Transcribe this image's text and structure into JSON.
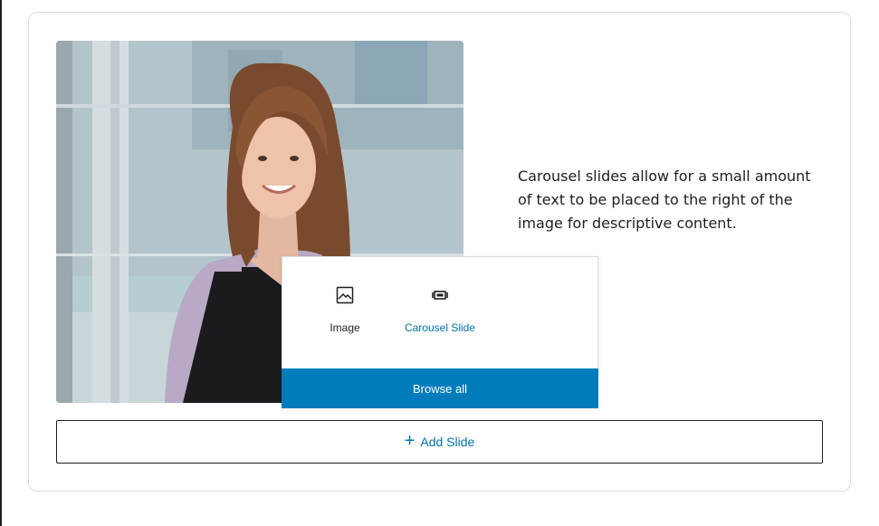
{
  "slide": {
    "description": "Carousel slides allow for a small amount of text to be placed to the right of the image for descriptive content."
  },
  "inserter": {
    "items": [
      {
        "label": "Image",
        "icon": "image-icon"
      },
      {
        "label": "Carousel Slide",
        "icon": "carousel-slide-icon"
      }
    ],
    "browse_all_label": "Browse all"
  },
  "add_slide": {
    "icon": "plus-icon",
    "label": "Add Slide"
  },
  "colors": {
    "accent": "#007cba",
    "link": "#0073aa",
    "text": "#1e1e1e",
    "border": "#dcdcde"
  }
}
